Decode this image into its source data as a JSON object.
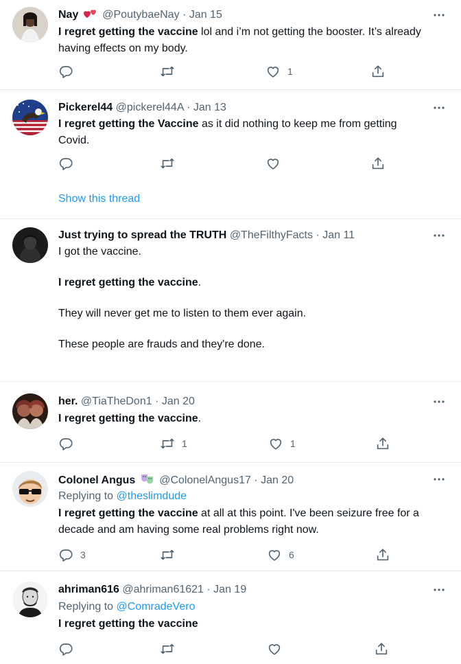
{
  "tweets": [
    {
      "name": "Nay",
      "handle": "@PoutybaeNay",
      "date": "Jan 15",
      "text_bold": "I regret getting the vaccine",
      "text_rest_line1": " lol and i’m not getting the booster. It’s already",
      "text_line2": "having effects on my body.",
      "replies": "",
      "retweets": "",
      "likes": "1"
    },
    {
      "name": "Pickerel44",
      "handle": "@pickerel44A",
      "date": "Jan 13",
      "text_bold": "I regret getting the Vaccine",
      "text_rest_line1": " as it did nothing to keep me from getting",
      "text_line2": "Covid.",
      "replies": "",
      "retweets": "",
      "likes": "",
      "show_thread": "Show this thread"
    },
    {
      "name": "Just trying to spread the TRUTH",
      "handle": "@TheFilthyFacts",
      "date": "Jan 11",
      "para1": "I got the vaccine.",
      "para2_bold": "I regret getting the vaccine",
      "para2_rest": ".",
      "para3": "They will never get me to listen to them ever again.",
      "para4": "These people are frauds and they're done."
    },
    {
      "name": "her.",
      "handle": "@TiaTheDon1",
      "date": "Jan 20",
      "text_bold": "I regret getting the vaccine",
      "text_rest_line1": ".",
      "replies": "",
      "retweets": "1",
      "likes": "1"
    },
    {
      "name": "Colonel Angus",
      "handle": "@ColonelAngus17",
      "date": "Jan 20",
      "replying_prefix": "Replying to ",
      "replying_handle": "@theslimdude",
      "text_bold": "I regret getting the vaccine",
      "text_rest_line1": " at all at this point. I've been seizure free for a",
      "text_line2": "decade and am having some real problems right now.",
      "replies": "3",
      "retweets": "",
      "likes": "6"
    },
    {
      "name": "ahriman616",
      "handle": "@ahriman61621",
      "date": "Jan 19",
      "replying_prefix": "Replying to ",
      "replying_handle": "@ComradeVero",
      "text_bold": "I regret getting the vaccine",
      "replies": "",
      "retweets": "",
      "likes": ""
    }
  ],
  "separator": "·",
  "colors": {
    "text": "#0f1419",
    "secondary": "#536471",
    "link": "#1d9bf0",
    "divider": "#e3e7ea"
  },
  "icons": [
    "reply-icon",
    "retweet-icon",
    "like-icon",
    "share-icon",
    "more-icon"
  ]
}
